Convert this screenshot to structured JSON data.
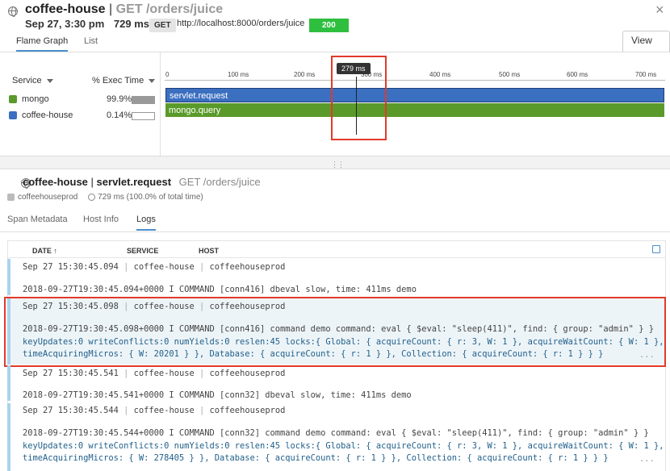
{
  "header": {
    "title": "coffee-house",
    "separator": "|",
    "endpoint": "GET /orders/juice",
    "datetime": "Sep 27, 3:30 pm",
    "duration": "729 ms",
    "method": "GET",
    "url": "http://localhost:8000/orders/juice",
    "status": "200",
    "tabs": [
      "Flame Graph",
      "List"
    ],
    "view_button": "View →",
    "close_icon": "×"
  },
  "flame": {
    "columns": {
      "service": "Service",
      "exec": "% Exec Time"
    },
    "legend": [
      {
        "name": "mongo",
        "percent": "99.9%",
        "color": "#5a9a2a",
        "fill": 0.999
      },
      {
        "name": "coffee-house",
        "percent": "0.14%",
        "color": "#3b6fc0",
        "fill": 0.0014
      }
    ],
    "ticks": [
      "0",
      "100 ms",
      "200 ms",
      "300 ms",
      "400 ms",
      "500 ms",
      "600 ms",
      "700 ms"
    ],
    "cursor_label": "279 ms",
    "spans": [
      {
        "label": "servlet.request",
        "color": "#3b6fc0"
      },
      {
        "label": "mongo.query",
        "color": "#5a9a2a"
      }
    ]
  },
  "details": {
    "service": "coffee-house",
    "separator": "|",
    "span": "servlet.request",
    "resource": "GET /orders/juice",
    "host": "coffeehouseprod",
    "duration_text": "729 ms (100.0% of total time)",
    "tabs": [
      "Span Metadata",
      "Host Info",
      "Logs"
    ]
  },
  "logs": {
    "headers": {
      "date": "DATE ↑",
      "service": "SERVICE",
      "host": "HOST"
    },
    "rows": [
      {
        "date": "Sep 27 15:30:45.094",
        "service": "coffee-house",
        "host": "coffeehouseprod",
        "msg1": "2018-09-27T19:30:45.094+0000 I COMMAND  [conn416] dbeval slow, time: 411ms demo"
      },
      {
        "date": "Sep 27 15:30:45.098",
        "service": "coffee-house",
        "host": "coffeehouseprod",
        "msg1": "2018-09-27T19:30:45.098+0000 I COMMAND  [conn416] command demo command: eval { $eval: \"sleep(411)\", find: { group: \"admin\" } }",
        "msg2": "keyUpdates:0 writeConflicts:0 numYields:0 reslen:45 locks:{ Global: { acquireCount: { r: 3, W: 1 }, acquireWaitCount: { W: 1 },",
        "msg3": "timeAcquiringMicros: { W: 20201 } }, Database: { acquireCount: { r: 1 } }, Collection: { acquireCount: { r: 1 } } }"
      },
      {
        "date": "Sep 27 15:30:45.541",
        "service": "coffee-house",
        "host": "coffeehouseprod",
        "msg1": "2018-09-27T19:30:45.541+0000 I COMMAND  [conn32] dbeval slow, time: 411ms demo"
      },
      {
        "date": "Sep 27 15:30:45.544",
        "service": "coffee-house",
        "host": "coffeehouseprod",
        "msg1": "2018-09-27T19:30:45.544+0000 I COMMAND  [conn32] command demo command: eval { $eval: \"sleep(411)\", find: { group: \"admin\" } }",
        "msg2": "keyUpdates:0 writeConflicts:0 numYields:0 reslen:45 locks:{ Global: { acquireCount: { r: 3, W: 1 }, acquireWaitCount: { W: 1 },",
        "msg3": "timeAcquiringMicros: { W: 278405 } }, Database: { acquireCount: { r: 1 } }, Collection: { acquireCount: { r: 1 } } }"
      }
    ],
    "ellipsis": "..."
  }
}
